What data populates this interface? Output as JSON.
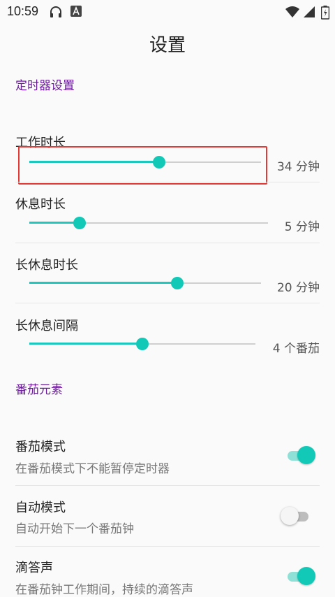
{
  "status_bar": {
    "time": "10:59"
  },
  "page_title": "设置",
  "timer_section": {
    "title": "定时器设置",
    "items": [
      {
        "label": "工作时长",
        "value_text": "34 分钟",
        "fraction": 0.56
      },
      {
        "label": "休息时长",
        "value_text": "5 分钟",
        "fraction": 0.21
      },
      {
        "label": "长休息时长",
        "value_text": "20 分钟",
        "fraction": 0.64
      },
      {
        "label": "长休息间隔",
        "value_text": "4 个番茄",
        "fraction": 0.5
      }
    ]
  },
  "tomato_section": {
    "title": "番茄元素",
    "items": [
      {
        "label": "番茄模式",
        "description": "在番茄模式下不能暂停定时器",
        "enabled": true
      },
      {
        "label": "自动模式",
        "description": "自动开始下一个番茄钟",
        "enabled": false
      },
      {
        "label": "滴答声",
        "description": "在番茄钟工作期间，持续的滴答声",
        "enabled": true
      }
    ]
  },
  "colors": {
    "accent": "#12c9b8",
    "section_title": "#6a1b9a",
    "highlight": "#e53935"
  },
  "icons": [
    "headphones-icon",
    "a-notification-icon",
    "wifi-icon",
    "signal-icon",
    "battery-icon"
  ]
}
